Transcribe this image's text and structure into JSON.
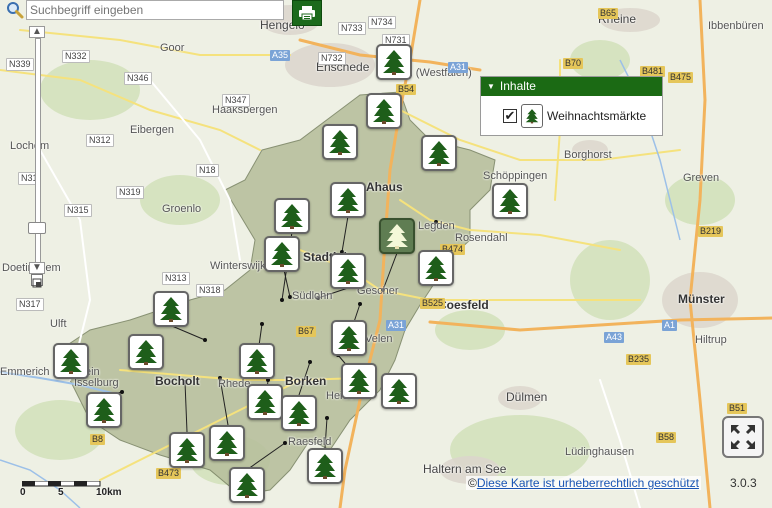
{
  "search": {
    "placeholder": "Suchbegriff eingeben"
  },
  "legend": {
    "title": "Inhalte",
    "layer_label": "Weihnachtsmärkte",
    "layer_checked": true
  },
  "scale": {
    "labels": [
      "0",
      "5",
      "10km"
    ]
  },
  "footer": {
    "copyright_prefix": "©",
    "copyright_link": "Diese Karte ist urheberrechtlich geschützt",
    "version": "3.0.3"
  },
  "colors": {
    "accent_green": "#1b6a14",
    "tree_green": "#1e5e1a",
    "district_fill": "#b7bf9c"
  },
  "places": [
    {
      "name": "Hengelo"
    },
    {
      "name": "Enschede"
    },
    {
      "name": "Gronau (Westfalen)"
    },
    {
      "name": "Rheine"
    },
    {
      "name": "Ibbenbüren"
    },
    {
      "name": "Haaksbergen"
    },
    {
      "name": "Ahaus"
    },
    {
      "name": "Stadtlohn"
    },
    {
      "name": "Legden"
    },
    {
      "name": "Rosendahl"
    },
    {
      "name": "Schöppingen"
    },
    {
      "name": "Borghorst"
    },
    {
      "name": "Greven"
    },
    {
      "name": "Südlohn"
    },
    {
      "name": "Gescher"
    },
    {
      "name": "Coesfeld"
    },
    {
      "name": "Münster"
    },
    {
      "name": "Hiltrup"
    },
    {
      "name": "Winterswijk"
    },
    {
      "name": "Groenlo"
    },
    {
      "name": "Ulft"
    },
    {
      "name": "Isselburg"
    },
    {
      "name": "Bocholt"
    },
    {
      "name": "Rhede"
    },
    {
      "name": "Borken"
    },
    {
      "name": "Velen"
    },
    {
      "name": "Heiden"
    },
    {
      "name": "Dülmen"
    },
    {
      "name": "Lüdinghausen"
    },
    {
      "name": "Raesfeld"
    },
    {
      "name": "Haltern am See"
    },
    {
      "name": "Emmerich am Rhein"
    },
    {
      "name": "Goor"
    },
    {
      "name": "Eibergen"
    },
    {
      "name": "Lochem"
    },
    {
      "name": "Doetinchem"
    }
  ],
  "roads": [
    {
      "label": "N339"
    },
    {
      "label": "N332"
    },
    {
      "label": "N346"
    },
    {
      "label": "N347"
    },
    {
      "label": "N312"
    },
    {
      "label": "N18"
    },
    {
      "label": "N319"
    },
    {
      "label": "N315"
    },
    {
      "label": "N313"
    },
    {
      "label": "N318"
    },
    {
      "label": "N317"
    },
    {
      "label": "N733"
    },
    {
      "label": "N734"
    },
    {
      "label": "N731"
    },
    {
      "label": "N732"
    },
    {
      "label": "A35"
    },
    {
      "label": "A31"
    },
    {
      "label": "B54"
    },
    {
      "label": "B70"
    },
    {
      "label": "B65"
    },
    {
      "label": "B481"
    },
    {
      "label": "B475"
    },
    {
      "label": "A1"
    },
    {
      "label": "A43"
    },
    {
      "label": "B219"
    },
    {
      "label": "B474"
    },
    {
      "label": "B525"
    },
    {
      "label": "B67"
    },
    {
      "label": "B235"
    },
    {
      "label": "B58"
    },
    {
      "label": "B473"
    },
    {
      "label": "B8"
    },
    {
      "label": "N31"
    },
    {
      "label": "B51"
    }
  ]
}
